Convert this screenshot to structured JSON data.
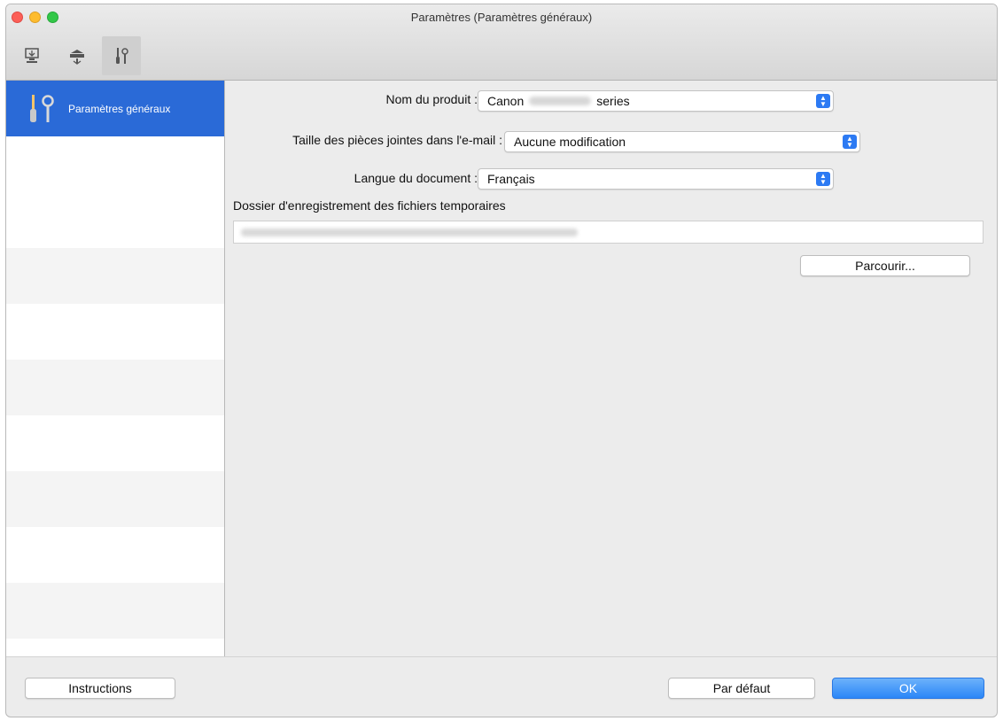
{
  "window": {
    "title": "Paramètres (Paramètres généraux)"
  },
  "toolbar": {
    "tools": [
      {
        "icon": "scan-computer-icon"
      },
      {
        "icon": "scanner-icon"
      },
      {
        "icon": "general-settings-icon",
        "selected": true
      }
    ]
  },
  "sidebar": {
    "selected_label": "Paramètres généraux",
    "icon": "general-settings-icon"
  },
  "form": {
    "product_label": "Nom du produit :",
    "product_value_prefix": "Canon",
    "product_value_suffix": "series",
    "attachment_label": "Taille des pièces jointes dans l'e-mail :",
    "attachment_value": "Aucune modification",
    "language_label": "Langue du document :",
    "language_value": "Français",
    "temp_folder_label": "Dossier d'enregistrement des fichiers temporaires",
    "browse_label": "Parcourir..."
  },
  "footer": {
    "instructions_label": "Instructions",
    "default_label": "Par défaut",
    "ok_label": "OK"
  },
  "colors": {
    "selection": "#2a6ad7",
    "accent": "#2c7af3"
  }
}
